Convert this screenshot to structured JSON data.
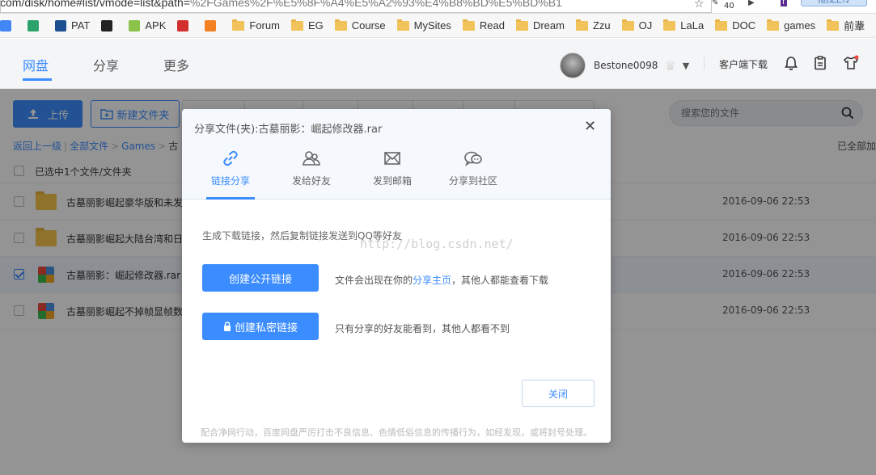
{
  "browser": {
    "url_domain": "com/disk/home#list/vmode=list&path=",
    "url_path": "%2FGames%2F%E5%8F%A4%E5%A2%93%E4%B8%BD%E5%BD%B1",
    "ext_badge": "40",
    "upload_tip": "拖拽上传"
  },
  "bookmarks": {
    "items": [
      {
        "label": "",
        "icon": "apps-icon",
        "color": "#4285f4"
      },
      {
        "label": "",
        "icon": "s-icon",
        "color": "#2ba36a"
      },
      {
        "label": "PAT",
        "icon": "pat-icon",
        "color": "#1d4f91"
      },
      {
        "label": "",
        "icon": "github-icon",
        "color": "#222"
      },
      {
        "label": "APK",
        "icon": "android-icon",
        "color": "#8bc34a"
      },
      {
        "label": "",
        "icon": "c-icon",
        "color": "#d32f2f"
      },
      {
        "label": "",
        "icon": "stackoverflow-icon",
        "color": "#f48024"
      },
      {
        "label": "Forum",
        "icon": "folder-icon"
      },
      {
        "label": "EG",
        "icon": "folder-icon"
      },
      {
        "label": "Course",
        "icon": "folder-icon"
      },
      {
        "label": "MySites",
        "icon": "folder-icon"
      },
      {
        "label": "Read",
        "icon": "folder-icon"
      },
      {
        "label": "Dream",
        "icon": "folder-icon"
      },
      {
        "label": "Zzu",
        "icon": "folder-icon"
      },
      {
        "label": "OJ",
        "icon": "folder-icon"
      },
      {
        "label": "LaLa",
        "icon": "folder-icon"
      },
      {
        "label": "DOC",
        "icon": "folder-icon"
      },
      {
        "label": "games",
        "icon": "folder-icon"
      },
      {
        "label": "前辈",
        "icon": "folder-icon"
      }
    ],
    "more": "»"
  },
  "header": {
    "nav": [
      "网盘",
      "分享",
      "更多"
    ],
    "username": "Bestone0098",
    "client_download": "客户端下载"
  },
  "toolbar": {
    "upload": "上传",
    "new_folder": "新建文件夹",
    "search_placeholder": "搜索您的文件"
  },
  "breadcrumb": {
    "back": "返回上一级",
    "all": "全部文件",
    "games": "Games",
    "current": "古",
    "sep": "|",
    "arrow": ">"
  },
  "loaded_status": "已全部加",
  "selection_text": "已选中1个文件/文件夹",
  "files": [
    {
      "name": "古墓丽影崛起豪华版和未发",
      "date": "2016-09-06 22:53",
      "type": "folder",
      "checked": false
    },
    {
      "name": "古墓丽影崛起大陆台湾和日",
      "date": "2016-09-06 22:53",
      "type": "folder",
      "checked": false
    },
    {
      "name": "古墓丽影：崛起修改器.rar",
      "date": "2016-09-06 22:53",
      "type": "rar",
      "checked": true
    },
    {
      "name": "古墓丽影崛起不掉帧显帧数",
      "date": "2016-09-06 22:53",
      "type": "rar",
      "checked": false
    }
  ],
  "dialog": {
    "title": "分享文件(夹):古墓丽影：崛起修改器.rar",
    "close_symbol": "✕",
    "tabs": [
      "链接分享",
      "发给好友",
      "发到邮箱",
      "分享到社区"
    ],
    "description": "生成下载链接，然后复制链接发送到QQ等好友",
    "watermark": "http://blog.csdn.net/",
    "public_button": "创建公开链接",
    "public_note_pre": "文件会出现在你的",
    "public_note_link": "分享主页",
    "public_note_post": "，其他人都能查看下载",
    "private_button": "创建私密链接",
    "private_note": "只有分享的好友能看到，其他人都看不到",
    "close_button": "关闭",
    "footer": "配合净网行动，百度网盘严厉打击不良信息、色情低俗信息的传播行为，如经发现，或将封号处理。"
  },
  "colors": {
    "accent": "#3b8cff",
    "folder": "#f7c44a",
    "overlay": "rgba(0,0,0,0.42)"
  }
}
